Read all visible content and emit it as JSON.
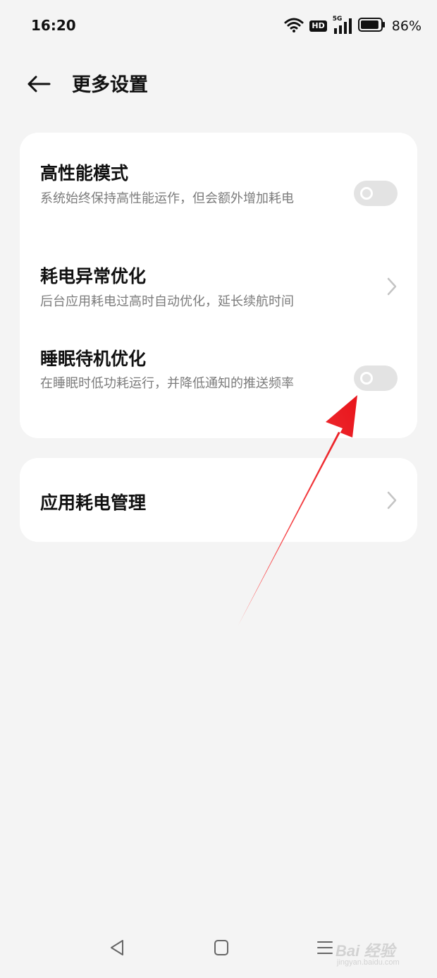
{
  "status_bar": {
    "time": "16:20",
    "hd_badge": "HD",
    "signal_label": "5G",
    "battery_percent": "86%",
    "battery_level": 0.86,
    "icons": [
      "wifi-icon",
      "hd-icon",
      "5g-signal-icon",
      "battery-icon"
    ]
  },
  "header": {
    "title": "更多设置",
    "back_icon": "arrow-left-icon"
  },
  "settings_card": {
    "items": [
      {
        "title": "高性能模式",
        "desc": "系统始终保持高性能运作，但会额外增加耗电",
        "control": "toggle",
        "enabled": false
      },
      {
        "title": "耗电异常优化",
        "desc": "后台应用耗电过高时自动优化，延长续航时间",
        "control": "chevron"
      },
      {
        "title": "睡眠待机优化",
        "desc": "在睡眠时低功耗运行，并降低通知的推送频率",
        "control": "toggle",
        "enabled": false
      }
    ]
  },
  "app_power_card": {
    "title": "应用耗电管理",
    "control": "chevron"
  },
  "nav_bar": {
    "icons": [
      "back-triangle-icon",
      "home-square-icon",
      "menu-lines-icon"
    ]
  },
  "watermark": {
    "logo": "Bai 经验",
    "sub": "jingyan.baidu.com"
  },
  "colors": {
    "background": "#f4f4f4",
    "card": "#ffffff",
    "toggle_off": "#e3e3e3",
    "secondary_text": "#7c7c7c",
    "annotation_arrow": "#e8141b"
  }
}
